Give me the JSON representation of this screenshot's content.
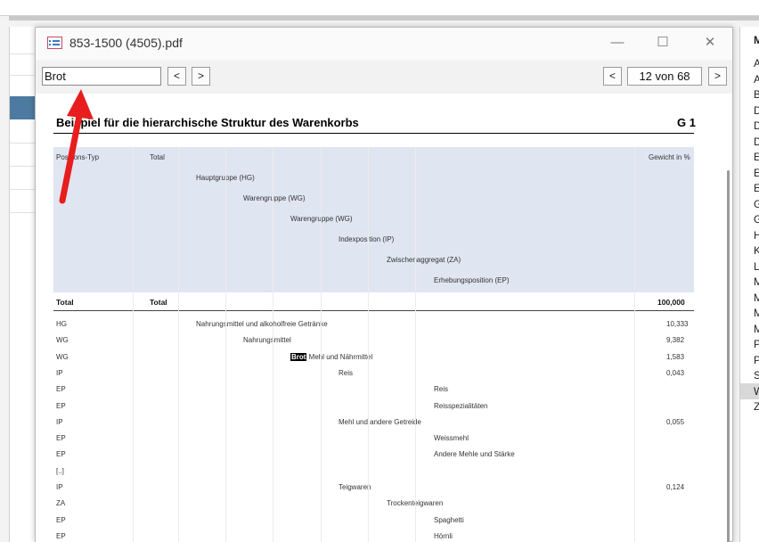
{
  "window": {
    "title": "853-1500 (4505).pdf"
  },
  "controls": {
    "minimize": "—",
    "maximize": "☐",
    "close": "✕"
  },
  "toolbar": {
    "search_value": "Brot",
    "prev_label": "<",
    "next_label": ">",
    "page_prev_label": "<",
    "page_indicator": "12 von 68",
    "page_next_label": ">"
  },
  "background_list": {
    "items": [
      "A",
      "A",
      "B",
      "D",
      "D",
      "D",
      "E",
      "E",
      "E",
      "G",
      "G",
      "H",
      "K",
      "L",
      "M",
      "M",
      "M",
      "M",
      "P",
      "P",
      "S",
      "W",
      "Z"
    ],
    "top_label": "M"
  },
  "document": {
    "title": "Beispiel für die hierarchische Struktur des Warenkorbs",
    "code": "G 1",
    "header": {
      "col_type": "Positions-Typ",
      "col_total": "Total",
      "col_weight": "Gewicht in %",
      "levels": [
        "Hauptgruppe (HG)",
        "Warengruppe (WG)",
        "Warengruppe (WG)",
        "Indexposition (IP)",
        "Zwischenaggregat (ZA)",
        "Erhebungsposition (EP)"
      ]
    },
    "total_row": {
      "type": "Total",
      "total": "Total",
      "weight": "100,000"
    },
    "rows": [
      {
        "type": "HG",
        "level": 1,
        "text": "Nahrungsmittel und alkoholfreie Getränke",
        "weight": "10,333"
      },
      {
        "type": "WG",
        "level": 2,
        "text": "Nahrungsmittel",
        "weight": "9,382"
      },
      {
        "type": "WG",
        "level": 3,
        "text": "Mehl und Nährmittel",
        "highlight": "Brot",
        "weight": "1,583"
      },
      {
        "type": "IP",
        "level": 4,
        "text": "Reis",
        "weight": "0,043"
      },
      {
        "type": "EP",
        "level": 6,
        "text": "Reis",
        "weight": ""
      },
      {
        "type": "EP",
        "level": 6,
        "text": "Reisspezialitäten",
        "weight": ""
      },
      {
        "type": "IP",
        "level": 4,
        "text": "Mehl und andere Getreide",
        "weight": "0,055"
      },
      {
        "type": "EP",
        "level": 6,
        "text": "Weissmehl",
        "weight": ""
      },
      {
        "type": "EP",
        "level": 6,
        "text": "Andere Mehle und Stärke",
        "weight": ""
      },
      {
        "type": "[..]",
        "level": 0,
        "text": "",
        "weight": ""
      },
      {
        "type": "IP",
        "level": 4,
        "text": "Teigwaren",
        "weight": "0,124"
      },
      {
        "type": "ZA",
        "level": 5,
        "text": "Trockenteigwaren",
        "weight": ""
      },
      {
        "type": "EP",
        "level": 6,
        "text": "Spaghetti",
        "weight": ""
      },
      {
        "type": "EP",
        "level": 6,
        "text": "Hörnli",
        "weight": ""
      }
    ]
  },
  "colors": {
    "accent_arrow": "#e81d1d",
    "header_band": "#dfe5f1",
    "selection": "#4d7aa0"
  }
}
